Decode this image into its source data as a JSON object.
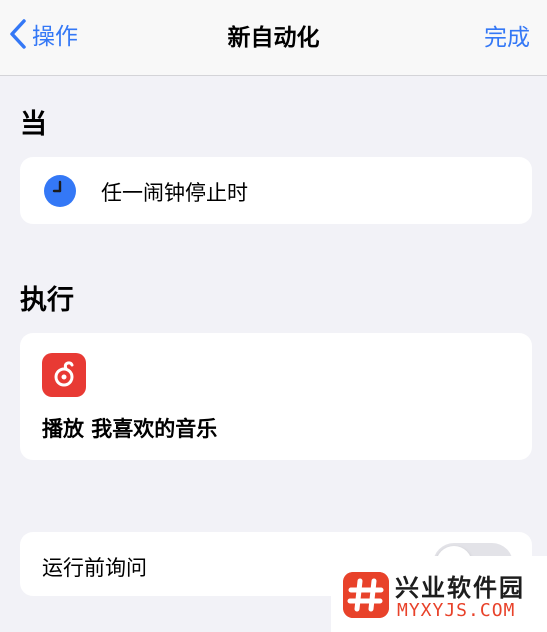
{
  "nav": {
    "back_label": "操作",
    "title": "新自动化",
    "done_label": "完成"
  },
  "when_section": {
    "title": "当",
    "trigger": {
      "icon": "clock-icon",
      "label": "任一闹钟停止时"
    }
  },
  "do_section": {
    "title": "执行",
    "action": {
      "icon": "netease-music-icon",
      "label": "播放 我喜欢的音乐"
    }
  },
  "ask_before_running": {
    "label": "运行前询问",
    "enabled": false
  },
  "watermark": {
    "name": "兴业软件园",
    "site": "MYXYJS.COM"
  },
  "colors": {
    "accent": "#3478f6",
    "background": "#f2f2f7",
    "app_icon": "#e83a34",
    "watermark": "#e8422a"
  }
}
